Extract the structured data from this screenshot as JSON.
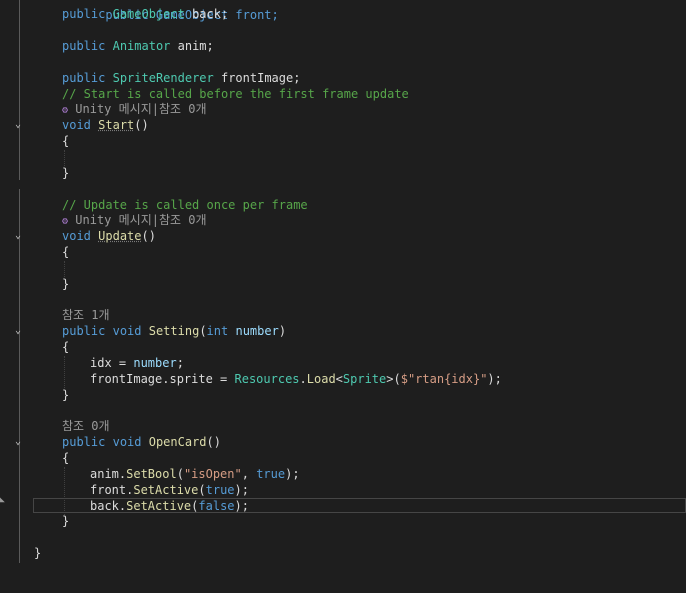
{
  "code": {
    "line_front_partial": "public GameObject front;",
    "line_back": {
      "kw": "public",
      "type": "GameObject",
      "name": "back;"
    },
    "line_anim": {
      "kw": "public",
      "type": "Animator",
      "name": "anim;"
    },
    "line_frontimage": {
      "kw": "public",
      "type": "SpriteRenderer",
      "name": "frontImage;"
    },
    "comment_start": "// Start is called before the first frame update",
    "comment_update": "// Update is called once per frame",
    "unity_lens": "Unity 메시지|참조 0개",
    "ref_one": "참조 1개",
    "ref_zero": "참조 0개",
    "start_sig": {
      "kw": "void",
      "name": "Start",
      "parens": "()"
    },
    "update_sig": {
      "kw": "void",
      "name": "Update",
      "parens": "()"
    },
    "setting_sig": {
      "kw1": "public",
      "kw2": "void",
      "name": "Setting",
      "open": "(",
      "ptype": "int",
      "pname": "number",
      "close": ")"
    },
    "opencard_sig": {
      "kw1": "public",
      "kw2": "void",
      "name": "OpenCard",
      "parens": "()"
    },
    "brace_open": "{",
    "brace_close": "}",
    "idx_line": {
      "a": "idx = ",
      "b": "number",
      "c": ";"
    },
    "frontimage_line": {
      "a": "frontImage.sprite = ",
      "cls": "Resources",
      "dot": ".",
      "m": "Load",
      "lt": "<",
      "gtype": "Sprite",
      "gt": ">(",
      "str": "$\"rtan{idx}\"",
      "end": ");"
    },
    "anim_line": {
      "a": "anim.",
      "m": "SetBool",
      "open": "(",
      "str": "\"isOpen\"",
      "comma": ", ",
      "val": "true",
      "end": ");"
    },
    "front_line": {
      "a": "front.",
      "m": "SetActive",
      "open": "(",
      "val": "true",
      "end": ");"
    },
    "back_line": {
      "a": "back.",
      "m": "SetActive",
      "open": "(",
      "val": "false",
      "end": ");"
    }
  },
  "colors": {
    "background": "#1e1e1e",
    "keyword": "#569cd6",
    "type": "#4ec9b0",
    "method": "#dcdcaa",
    "parameter": "#9cdcfe",
    "string": "#d69d85",
    "comment": "#57a64a",
    "codelens": "#9a9a9a"
  },
  "icons": {
    "fold": "chevron-down-icon",
    "unity": "unity-icon"
  }
}
